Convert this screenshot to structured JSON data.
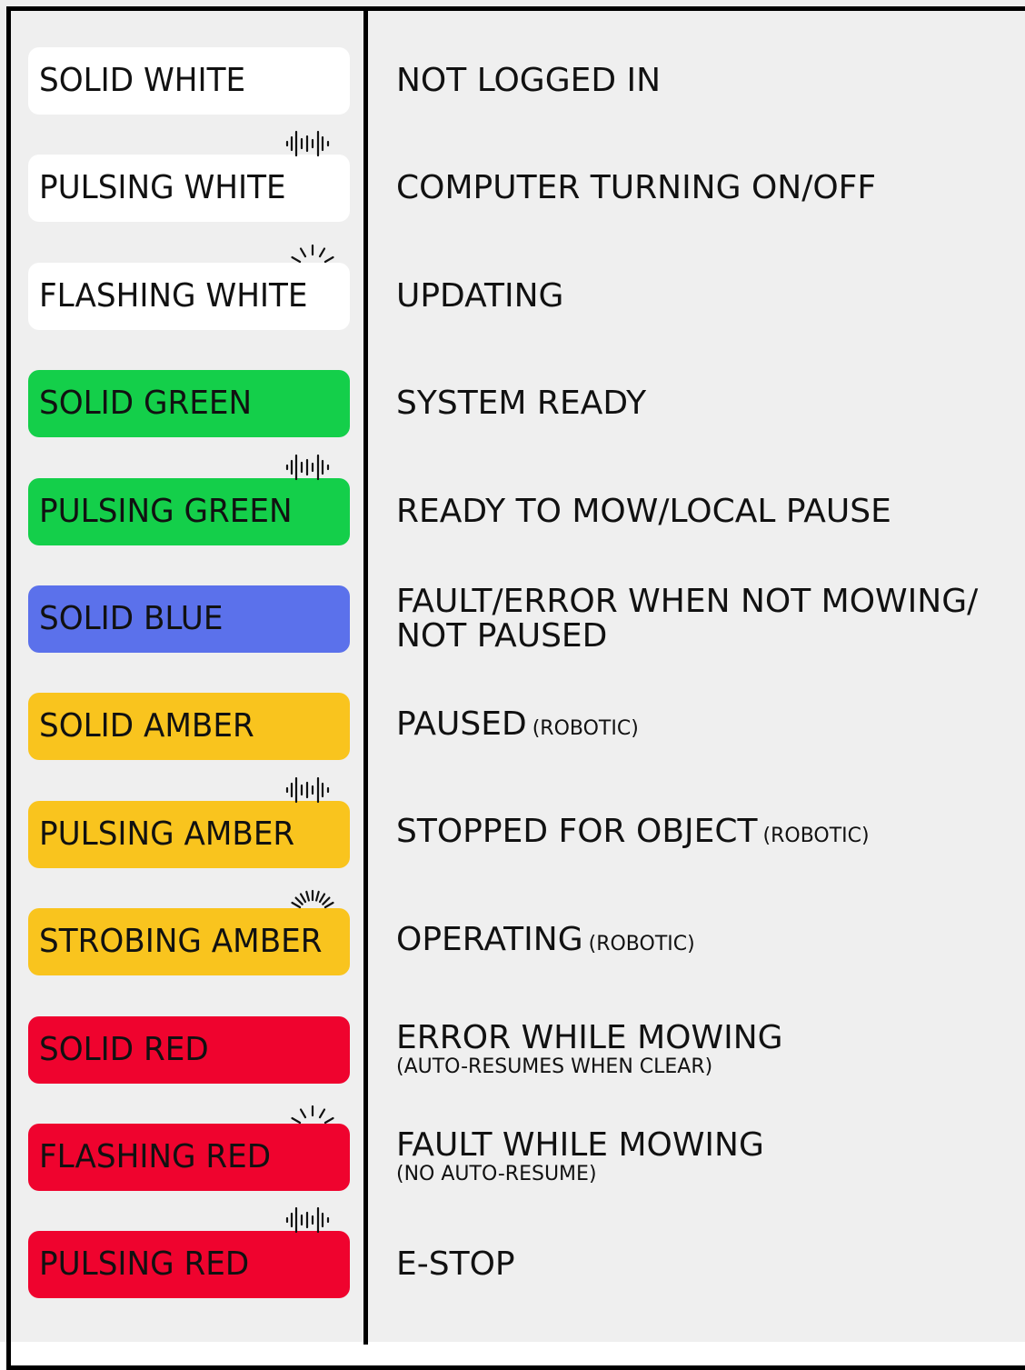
{
  "colors": {
    "white": "#ffffff",
    "green": "#14cf4a",
    "blue": "#5b71eb",
    "amber": "#f9c41e",
    "red": "#ef032e",
    "panel_bg": "#efefef",
    "border": "#000000",
    "text": "#111111"
  },
  "rows": [
    {
      "light": "SOLID WHITE",
      "color": "#ffffff",
      "text_color": "#111111",
      "icon": "none",
      "meaning": "NOT LOGGED IN",
      "qualifier": "",
      "sub": ""
    },
    {
      "light": "PULSING WHITE",
      "color": "#ffffff",
      "text_color": "#111111",
      "icon": "pulse-waveform-icon",
      "meaning": "COMPUTER TURNING ON/OFF",
      "qualifier": "",
      "sub": ""
    },
    {
      "light": "FLASHING WHITE",
      "color": "#ffffff",
      "text_color": "#111111",
      "icon": "flash-rays-icon",
      "meaning": "UPDATING",
      "qualifier": "",
      "sub": ""
    },
    {
      "light": "SOLID GREEN",
      "color": "#14cf4a",
      "text_color": "#111111",
      "icon": "none",
      "meaning": "SYSTEM READY",
      "qualifier": "",
      "sub": ""
    },
    {
      "light": "PULSING GREEN",
      "color": "#14cf4a",
      "text_color": "#111111",
      "icon": "pulse-waveform-icon",
      "meaning": "READY TO MOW/LOCAL PAUSE",
      "qualifier": "",
      "sub": ""
    },
    {
      "light": "SOLID BLUE",
      "color": "#5b71eb",
      "text_color": "#111111",
      "icon": "none",
      "meaning": "FAULT/ERROR WHEN NOT MOWING/ NOT PAUSED",
      "qualifier": "",
      "sub": ""
    },
    {
      "light": "SOLID AMBER",
      "color": "#f9c41e",
      "text_color": "#111111",
      "icon": "none",
      "meaning": "PAUSED",
      "qualifier": "(ROBOTIC)",
      "sub": ""
    },
    {
      "light": "PULSING AMBER",
      "color": "#f9c41e",
      "text_color": "#111111",
      "icon": "pulse-waveform-icon",
      "meaning": "STOPPED FOR OBJECT",
      "qualifier": "(ROBOTIC)",
      "sub": ""
    },
    {
      "light": "STROBING AMBER",
      "color": "#f9c41e",
      "text_color": "#111111",
      "icon": "strobe-rays-icon",
      "meaning": "OPERATING",
      "qualifier": "(ROBOTIC)",
      "sub": ""
    },
    {
      "light": "SOLID RED",
      "color": "#ef032e",
      "text_color": "#111111",
      "icon": "none",
      "meaning": "ERROR WHILE MOWING",
      "qualifier": "",
      "sub": "(AUTO-RESUMES WHEN CLEAR)"
    },
    {
      "light": "FLASHING RED",
      "color": "#ef032e",
      "text_color": "#111111",
      "icon": "flash-rays-icon",
      "meaning": "FAULT WHILE MOWING",
      "qualifier": "",
      "sub": "(NO AUTO-RESUME)"
    },
    {
      "light": "PULSING RED",
      "color": "#ef032e",
      "text_color": "#111111",
      "icon": "pulse-waveform-icon",
      "meaning": "E-STOP",
      "qualifier": "",
      "sub": ""
    }
  ]
}
